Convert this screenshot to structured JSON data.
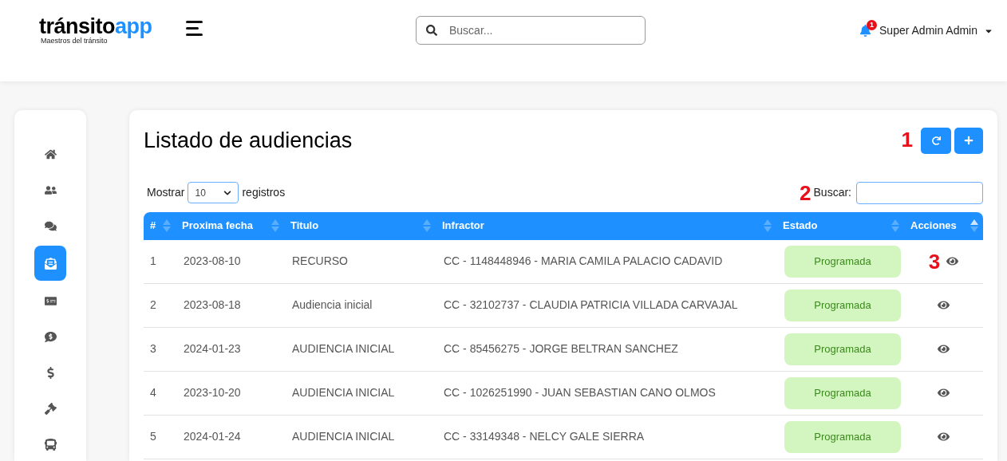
{
  "header": {
    "logo": {
      "word": "tránsito",
      "accent": "app",
      "tagline": "Maestros del tránsito"
    },
    "search": {
      "placeholder": "Buscar..."
    },
    "notifications": {
      "count": "1"
    },
    "user": {
      "name": "Super Admin Admin"
    }
  },
  "sidebar": {
    "items": [
      {
        "selected": false
      },
      {
        "selected": false
      },
      {
        "selected": false
      },
      {
        "selected": true
      },
      {
        "selected": false
      },
      {
        "selected": false
      },
      {
        "selected": false
      },
      {
        "selected": false
      },
      {
        "selected": false
      }
    ]
  },
  "card": {
    "title": "Listado de audiencias",
    "toolbar_marker": "1",
    "length": {
      "before": "Mostrar",
      "value": "10",
      "after": "registros"
    },
    "filter": {
      "marker": "2",
      "label": "Buscar:"
    },
    "table": {
      "columns": [
        {
          "label": "#",
          "sorted": false
        },
        {
          "label": "Proxima fecha",
          "sorted": false
        },
        {
          "label": "Titulo",
          "sorted": false
        },
        {
          "label": "Infractor",
          "sorted": false
        },
        {
          "label": "Estado",
          "sorted": false
        },
        {
          "label": "Acciones",
          "sorted": true
        }
      ],
      "rows": [
        {
          "n": "1",
          "date": "2023-08-10",
          "title": "RECURSO",
          "offender": "CC - 1148448946 - MARIA CAMILA PALACIO CADAVID",
          "status": "Programada",
          "marker": "3"
        },
        {
          "n": "2",
          "date": "2023-08-18",
          "title": "Audiencia inicial",
          "offender": "CC - 32102737 - CLAUDIA PATRICIA VILLADA CARVAJAL",
          "status": "Programada"
        },
        {
          "n": "3",
          "date": "2024-01-23",
          "title": "AUDIENCIA INICIAL",
          "offender": "CC - 85456275 - JORGE BELTRAN SANCHEZ",
          "status": "Programada"
        },
        {
          "n": "4",
          "date": "2023-10-20",
          "title": "AUDIENCIA INICIAL",
          "offender": "CC - 1026251990 - JUAN SEBASTIAN CANO OLMOS",
          "status": "Programada"
        },
        {
          "n": "5",
          "date": "2024-01-24",
          "title": "AUDIENCIA INICIAL",
          "offender": "CC - 33149348 - NELCY GALE SIERRA",
          "status": "Programada"
        }
      ]
    }
  }
}
